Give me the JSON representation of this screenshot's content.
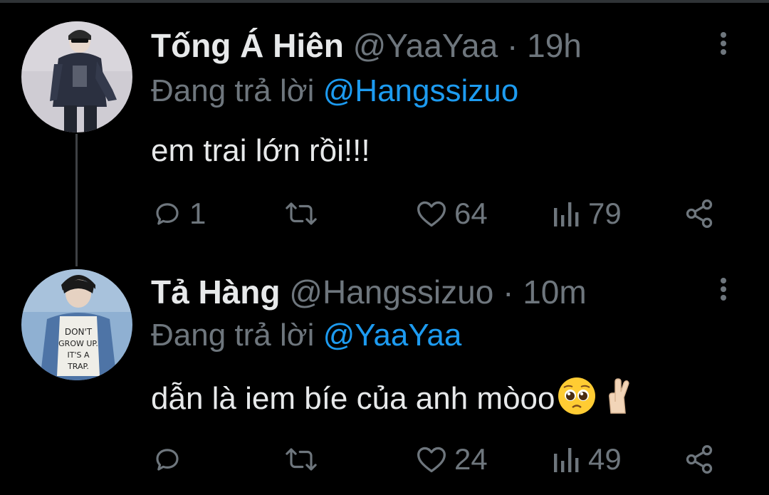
{
  "tweets": [
    {
      "name": "Tống Á Hiên",
      "handle": "@YaaYaa",
      "separator": "·",
      "time": "19h",
      "reply_prefix": "Đang trả lời ",
      "reply_to": "@Hangssizuo",
      "text": "em trai lớn rồi!!!",
      "emojis": [],
      "actions": {
        "replies": "1",
        "retweets": "",
        "likes": "64",
        "views": "79"
      },
      "avatar_bg": "#c9c6cf"
    },
    {
      "name": "Tả Hàng",
      "handle": "@Hangssizuo",
      "separator": "·",
      "time": "10m",
      "reply_prefix": "Đang trả lời ",
      "reply_to": "@YaaYaa",
      "text": "dẫn là iem bíe của anh mòoo",
      "emojis": [
        "pleading-face-emoji",
        "crossed-fingers-emoji"
      ],
      "actions": {
        "replies": "",
        "retweets": "",
        "likes": "24",
        "views": "49"
      },
      "avatar_bg": "#7ea2c9"
    }
  ],
  "colors": {
    "background": "#000000",
    "text_primary": "#e7e9ea",
    "text_secondary": "#6e767d",
    "mention": "#1d9bf0",
    "thread_line": "#3e4144"
  },
  "icons": {
    "reply": "reply-icon",
    "retweet": "retweet-icon",
    "like": "heart-icon",
    "views": "views-icon",
    "share": "share-icon",
    "more": "more-icon"
  }
}
